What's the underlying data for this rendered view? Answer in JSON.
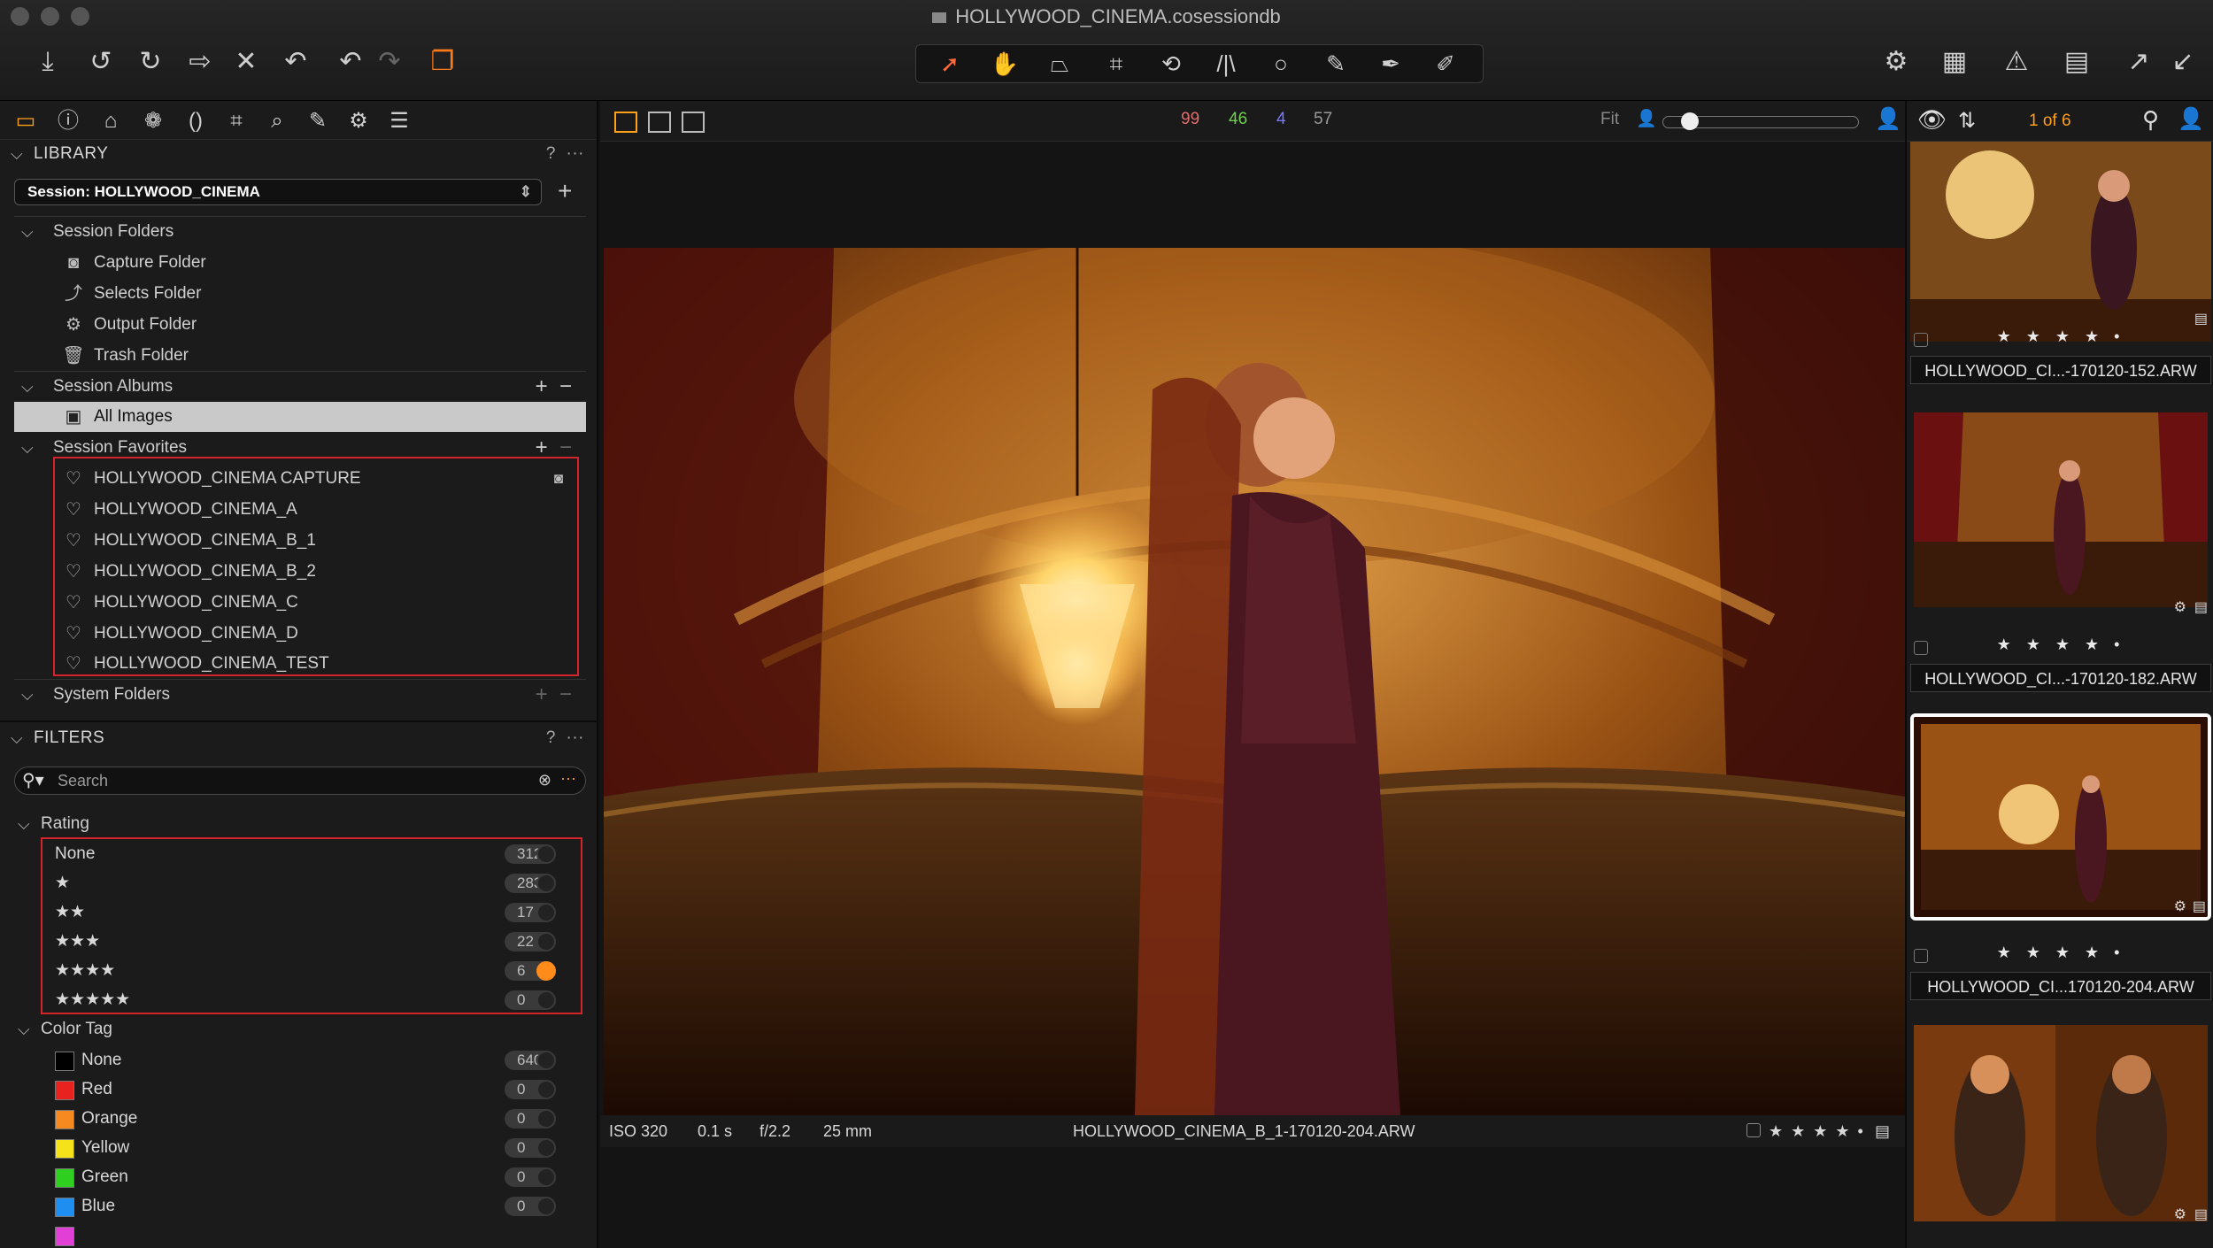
{
  "window": {
    "title": "HOLLYWOOD_CINEMA.cosessiondb"
  },
  "library": {
    "header": "LIBRARY",
    "help": "?",
    "more": "···",
    "session_select": "Session: HOLLYWOOD_CINEMA",
    "session_folders": {
      "label": "Session Folders",
      "items": [
        "Capture Folder",
        "Selects Folder",
        "Output Folder",
        "Trash Folder"
      ]
    },
    "session_albums": {
      "label": "Session Albums",
      "items": [
        "All Images"
      ]
    },
    "session_favorites": {
      "label": "Session Favorites",
      "items": [
        "HOLLYWOOD_CINEMA CAPTURE",
        "HOLLYWOOD_CINEMA_A",
        "HOLLYWOOD_CINEMA_B_1",
        "HOLLYWOOD_CINEMA_B_2",
        "HOLLYWOOD_CINEMA_C",
        "HOLLYWOOD_CINEMA_D",
        "HOLLYWOOD_CINEMA_TEST"
      ]
    },
    "system_folders": {
      "label": "System Folders"
    }
  },
  "filters": {
    "header": "FILTERS",
    "help": "?",
    "more": "···",
    "search_placeholder": "Search",
    "rating": {
      "label": "Rating",
      "rows": [
        {
          "label": "None",
          "count": "312",
          "active": false
        },
        {
          "label": "★",
          "count": "283",
          "active": false
        },
        {
          "label": "★★",
          "count": "17",
          "active": false
        },
        {
          "label": "★★★",
          "count": "22",
          "active": false
        },
        {
          "label": "★★★★",
          "count": "6",
          "active": true
        },
        {
          "label": "★★★★★",
          "count": "0",
          "active": false
        }
      ]
    },
    "color_tag": {
      "label": "Color Tag",
      "rows": [
        {
          "label": "None",
          "count": "640",
          "color": "#000000"
        },
        {
          "label": "Red",
          "count": "0",
          "color": "#e8231f"
        },
        {
          "label": "Orange",
          "count": "0",
          "color": "#f6891f"
        },
        {
          "label": "Yellow",
          "count": "0",
          "color": "#f5e21a"
        },
        {
          "label": "Green",
          "count": "0",
          "color": "#2fcf1f"
        },
        {
          "label": "Blue",
          "count": "0",
          "color": "#1e8ef0"
        }
      ]
    }
  },
  "viewer": {
    "counts": [
      {
        "value": "99",
        "color": "#e06c6c"
      },
      {
        "value": "46",
        "color": "#6fcf4f"
      },
      {
        "value": "4",
        "color": "#7a7aff"
      },
      {
        "value": "57",
        "color": "#9a9a9a"
      }
    ],
    "fit_label": "Fit",
    "zoom_level": 0.1,
    "info": {
      "iso": "ISO 320",
      "shutter": "0.1 s",
      "aperture": "f/2.2",
      "focal": "25 mm",
      "filename": "HOLLYWOOD_CINEMA_B_1-170120-204.ARW",
      "stars": "★ ★ ★ ★ •"
    }
  },
  "browser": {
    "page": "1 of 6",
    "thumbnails": [
      {
        "stars": "★ ★ ★ ★ •",
        "filename": "HOLLYWOOD_CI...-170120-152.ARW",
        "selected": false
      },
      {
        "stars": "★ ★ ★ ★ •",
        "filename": "HOLLYWOOD_CI...-170120-182.ARW",
        "selected": false
      },
      {
        "stars": "★ ★ ★ ★ •",
        "filename": "HOLLYWOOD_CI...170120-204.ARW",
        "selected": true
      },
      {
        "stars": "",
        "filename": "",
        "selected": false
      }
    ]
  },
  "colors": {
    "accent": "#ff9f1a",
    "highlight_box": "#d4242a"
  }
}
